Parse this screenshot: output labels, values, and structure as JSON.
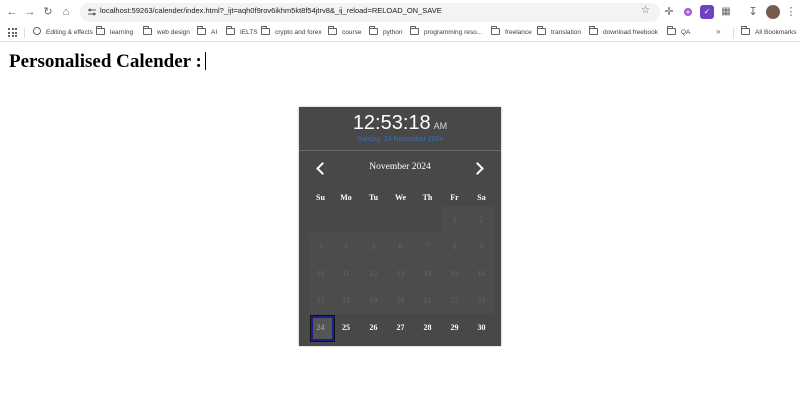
{
  "browser": {
    "url": "localhost:59263/calender/index.html?_ijt=aqh0f9rov6ikhm5kt8f54jtrv8&_ij_reload=RELOAD_ON_SAVE",
    "bookmarks": [
      "Editing & effects",
      "learning",
      "web design",
      "AI",
      "IELTS",
      "crypto and forex",
      "course",
      "python",
      "programming reso...",
      "freelance",
      "translation",
      "download freebook",
      "QA"
    ],
    "more_label": "»",
    "all_bookmarks": "All Bookmarks"
  },
  "page": {
    "title": "Personalised Calender :"
  },
  "calendar": {
    "time": "12:53:18",
    "ampm": "AM",
    "date_line": "Sunday, 24 November 2024",
    "month_label": "November 2024",
    "weekdays": [
      "Su",
      "Mo",
      "Tu",
      "We",
      "Th",
      "Fr",
      "Sa"
    ],
    "days": [
      "",
      "",
      "",
      "",
      "",
      "1",
      "2",
      "3",
      "4",
      "5",
      "6",
      "7",
      "8",
      "9",
      "10",
      "11",
      "12",
      "13",
      "14",
      "15",
      "16",
      "17",
      "18",
      "19",
      "20",
      "21",
      "22",
      "23",
      "24",
      "25",
      "26",
      "27",
      "28",
      "29",
      "30"
    ],
    "today": "24",
    "colors": {
      "background": "#484848",
      "past_day": "#5e5e5e",
      "today_border": "#1c1c8c",
      "date_line": "#3f6fa8"
    }
  }
}
